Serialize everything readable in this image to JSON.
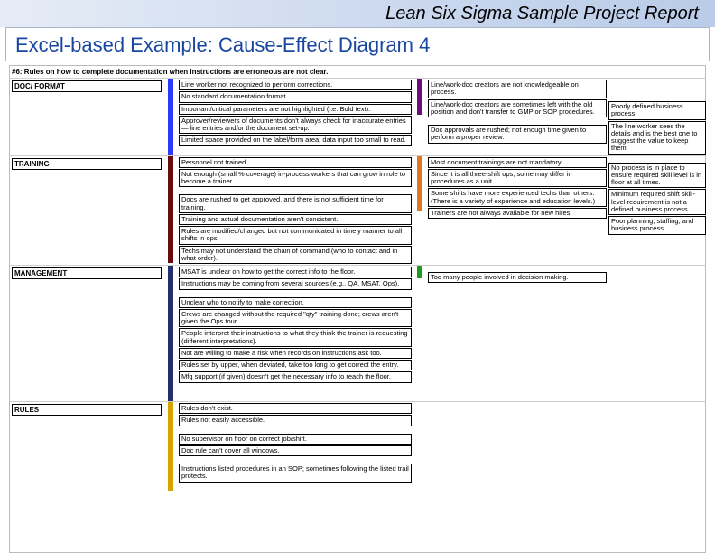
{
  "header": {
    "doc_title": "Lean Six Sigma Sample Project Report",
    "subtitle": "Excel-based Example: Cause-Effect Diagram 4"
  },
  "problem": "#6: Rules on how to complete documentation when instructions are erroneous are not clear.",
  "categories": {
    "doc_format": {
      "label": "DOC/ FORMAT",
      "color": "blue",
      "col1": [
        "Line worker not recognized to perform corrections.",
        "No standard documentation format.",
        "Important/critical parameters are not highlighted (i.e. Bold text).",
        "Approver/reviewers of documents don't always check for inaccurate entries — line entries and/or the document set-up.",
        "Limited space provided on the label/form area; data input too small to read."
      ],
      "col2": [
        "Line/work-doc creators are not knowledgeable on process.",
        "Line/work-doc creators are sometimes left with the old position and don't transfer to GMP or SOP procedures.",
        "Doc approvals are rushed; not enough time given to perform a proper review."
      ],
      "col3": [
        "Poorly defined business process.",
        "The line worker sees the details and is the best one to suggest the value to keep them."
      ]
    },
    "training": {
      "label": "TRAINING",
      "color": "darkred",
      "col1": [
        "Personnel not trained.",
        "Not enough (small % coverage) in-process workers that can grow in role to become a trainer.",
        "",
        "Docs are rushed to get approved, and there is not sufficient time for training.",
        "Training and actual documentation aren't consistent.",
        "Rules are modified/changed but not communicated in timely manner to all shifts in ops.",
        "Techs may not understand the chain of command (who to contact and in what order)."
      ],
      "col2_hl": "Most document trainings are not mandatory.",
      "col2": [
        "Since it is all three-shift ops, some may differ in procedures as a unit.",
        "Some shifts have more experienced techs than others. (There is a variety of experience and education levels.)",
        "Trainers are not always available for new hires."
      ],
      "col3": [
        "No process is in place to ensure required skill level is in floor at all times.",
        "Minimum required shift skill-level requirement is not a defined business process.",
        "Poor planning, staffing, and business process."
      ]
    },
    "management": {
      "label": "MANAGEMENT",
      "color": "darkblue",
      "col1": [
        "MSAT is unclear on how to get the correct info to the floor.",
        "Instructions may be coming from several sources (e.g., QA, MSAT, Ops).",
        "",
        "Unclear who to notify to make correction.",
        "Crews are changed without the required \"qty\" training done; crews aren't given the Ops tour.",
        "People interpret their instructions to what they think the trainer is requesting (different interpretations).",
        "Not are willing to make a risk when records on instructions ask too.",
        "Rules set by upper, when deviated, take too long to get correct the entry.",
        "Mfg support (if given) doesn't get the necessary info to reach the floor."
      ],
      "col2": [
        "Too many people involved in decision making."
      ]
    },
    "rules": {
      "label": "RULES",
      "color": "yellow",
      "col1": [
        "Rules don't exist.",
        "Rules not easily accessible.",
        "",
        "No supervisor on floor on correct job/shift.",
        "Doc rule can't cover all windows.",
        "",
        "Instructions listed procedures in an SOP; sometimes following the listed trail protects."
      ]
    }
  }
}
